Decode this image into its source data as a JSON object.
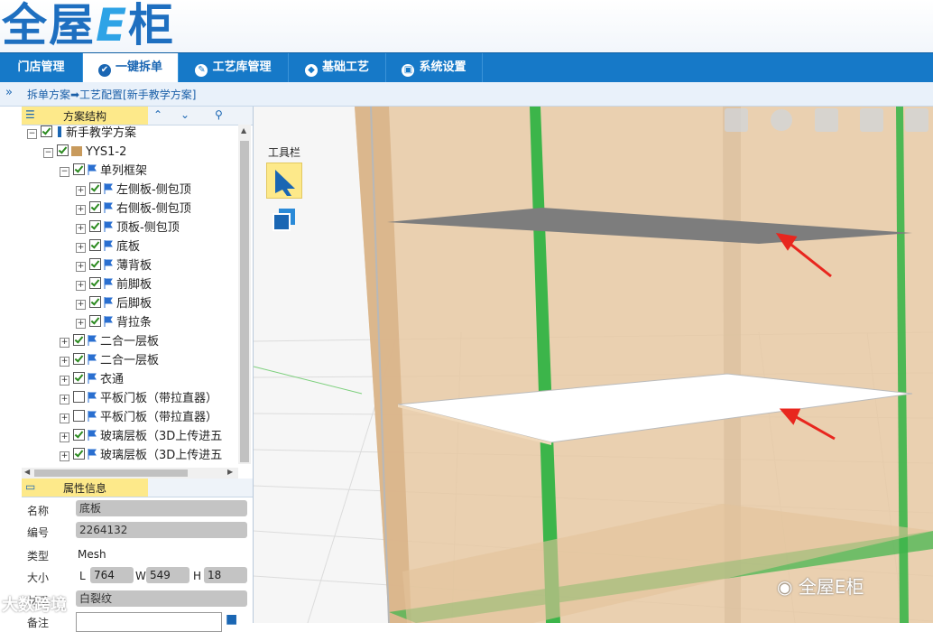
{
  "logo": {
    "text_a": "全屋",
    "text_e": "E",
    "text_b": "柜"
  },
  "nav": {
    "tabs": [
      {
        "label": "门店管理"
      },
      {
        "label": "一键拆单"
      },
      {
        "label": "工艺库管理"
      },
      {
        "label": "基础工艺"
      },
      {
        "label": "系统设置"
      }
    ]
  },
  "breadcrumb": {
    "text": "拆单方案➡工艺配置[新手教学方案]"
  },
  "structure_panel": {
    "title": "方案结构"
  },
  "tree": {
    "root": "新手教学方案",
    "cabinet": "YYS1-2",
    "frame": "单列框架",
    "frame_children": [
      "左侧板-侧包顶",
      "右侧板-侧包顶",
      "顶板-侧包顶",
      "底板",
      "薄背板",
      "前脚板",
      "后脚板",
      "背拉条"
    ],
    "siblings": [
      "二合一层板",
      "二合一层板",
      "衣通",
      "平板门板（带拉直器）",
      "平板门板（带拉直器）",
      "玻璃层板（3D上传进五",
      "玻璃层板（3D上传进五"
    ]
  },
  "props_panel": {
    "title": "属性信息"
  },
  "props": {
    "name_label": "名称",
    "name_value": "底板",
    "code_label": "编号",
    "code_value": "2264132",
    "type_label": "类型",
    "type_value": "Mesh",
    "size_label": "大小",
    "L_label": "L",
    "L_value": "764",
    "W_label": "W",
    "W_value": "549",
    "H_label": "H",
    "H_value": "18",
    "material_label": "材质",
    "material_value": "白裂纹",
    "note_label": "备注"
  },
  "toolbox": {
    "label": "工具栏"
  },
  "watermark_br": {
    "text": "全屋E柜"
  },
  "watermark_bl": {
    "text": "大数跨境"
  },
  "colors": {
    "nav": "#1679c8",
    "accent": "#1a66b3",
    "highlight": "#fde98a",
    "cabinet": "#e8c9a3",
    "frame_green": "#3cb54a"
  }
}
